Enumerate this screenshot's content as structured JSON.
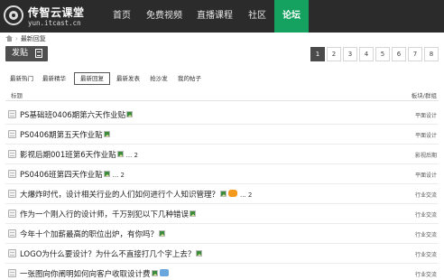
{
  "nav": {
    "logo_text": "传智云课堂",
    "logo_url": "yun.itcast.cn",
    "items": [
      "首页",
      "免费视频",
      "直播课程",
      "社区",
      "论坛"
    ],
    "active": "论坛"
  },
  "breadcrumb": {
    "separator": "›",
    "current": "最新回复"
  },
  "toolbar": {
    "post_label": "发贴"
  },
  "pagination": {
    "pages": [
      "1",
      "2",
      "3",
      "4",
      "5",
      "6",
      "7",
      "8"
    ],
    "current": "1"
  },
  "filters": {
    "tabs": [
      "最新热门",
      "最新精华",
      "最新回复",
      "最新发表",
      "抢沙发",
      "我的帖子"
    ],
    "active": "最新回复"
  },
  "table": {
    "columns": {
      "title": "标题",
      "board": "板块/群组"
    },
    "rows": [
      {
        "title": "PS基础班0406期第六天作业贴",
        "pages": "",
        "board": "平面设计"
      },
      {
        "title": "PS0406期第五天作业贴",
        "pages": "",
        "board": "平面设计"
      },
      {
        "title": "影视后期001班第6天作业贴",
        "pages": "... 2",
        "board": "影视后期"
      },
      {
        "title": "PS0406班第四天作业贴",
        "pages": "... 2",
        "board": "平面设计"
      },
      {
        "title": "大爆炸时代，设计相关行业的人们如何进行个人知识管理？",
        "pages": "... 2",
        "board": "行业交流"
      },
      {
        "title": "作为一个刚入行的设计师，千万别犯以下几种错误",
        "pages": "",
        "board": "行业交流"
      },
      {
        "title": "今年十个加薪最高的职位出炉，有你吗？",
        "pages": "",
        "board": "行业交流"
      },
      {
        "title": "LOGO为什么要设计？为什么不直接打几个字上去？",
        "pages": "",
        "board": "行业交流"
      },
      {
        "title": "一张图向你阐明如何向客户收取设计费",
        "pages": "",
        "board": "行业交流"
      }
    ]
  },
  "colors": {
    "nav_bg": "#2b2b2b",
    "nav_active": "#15a15f",
    "button_dark": "#4e4e4e"
  }
}
